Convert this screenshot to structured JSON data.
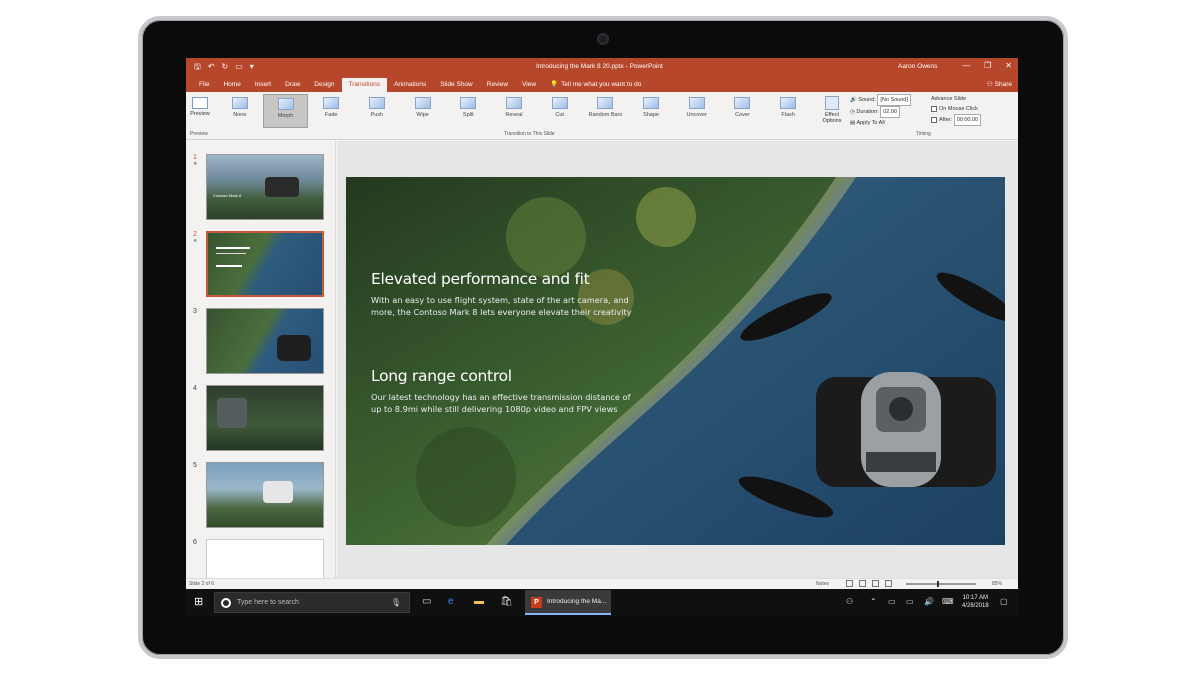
{
  "window": {
    "doc_title": "Introducing the Mark 8 20.pptx",
    "app_name": "PowerPoint",
    "user": "Aaron Owens",
    "minimize": "—",
    "restore": "❐",
    "close": "✕"
  },
  "tabs": [
    {
      "label": "File"
    },
    {
      "label": "Home"
    },
    {
      "label": "Insert"
    },
    {
      "label": "Draw"
    },
    {
      "label": "Design"
    },
    {
      "label": "Transitions",
      "active": true
    },
    {
      "label": "Animations"
    },
    {
      "label": "Slide Show"
    },
    {
      "label": "Review"
    },
    {
      "label": "View"
    }
  ],
  "tell_me": "Tell me what you want to do",
  "share": "Share",
  "ribbon": {
    "preview": "Preview",
    "transitions": [
      {
        "label": "None"
      },
      {
        "label": "Morph",
        "selected": true
      },
      {
        "label": "Fade"
      },
      {
        "label": "Push"
      },
      {
        "label": "Wipe"
      },
      {
        "label": "Split"
      },
      {
        "label": "Reveal"
      },
      {
        "label": "Cut"
      },
      {
        "label": "Random Bars"
      },
      {
        "label": "Shape"
      },
      {
        "label": "Uncover"
      },
      {
        "label": "Cover"
      },
      {
        "label": "Flash"
      }
    ],
    "effect_options": "Effect Options",
    "sound_label": "Sound:",
    "sound_value": "[No Sound]",
    "duration_label": "Duration:",
    "duration_value": "02.00",
    "apply_to_all": "Apply To All",
    "advance_slide": "Advance Slide",
    "on_mouse_click": "On Mouse Click",
    "after_label": "After:",
    "after_value": "00:00.00",
    "group_preview": "Preview",
    "group_transition": "Transition to This Slide",
    "group_timing": "Timing"
  },
  "thumbnails": [
    {
      "number": "1",
      "caption": "Contoso Mark 8"
    },
    {
      "number": "2",
      "selected": true
    },
    {
      "number": "3"
    },
    {
      "number": "4"
    },
    {
      "number": "5"
    },
    {
      "number": "6"
    }
  ],
  "slide": {
    "heading1": "Elevated performance and fit",
    "body1": "With an easy to use flight system, state of the art camera, and more, the Contoso Mark 8 lets everyone elevate their creativity",
    "heading2": "Long range control",
    "body2": "Our latest technology has an effective transmission distance of up to 8.9mi while still delivering 1080p video and FPV views"
  },
  "status": {
    "slide_count": "Slide 2 of 6",
    "notes": "Notes",
    "zoom_value": "85%",
    "zoom_level": 0.45
  },
  "taskbar": {
    "search_placeholder": "Type here to search",
    "app_label": "Introducing the Ma...",
    "time": "10:17 AM",
    "date": "4/26/2018"
  },
  "colors": {
    "accent": "#b7472a",
    "taskbar": "#101010"
  }
}
